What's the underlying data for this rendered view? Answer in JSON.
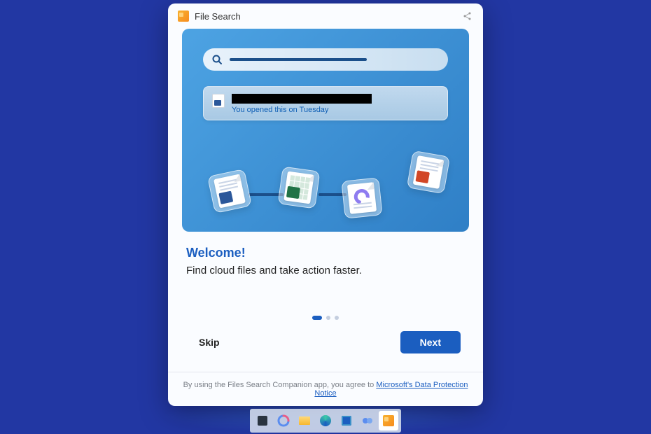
{
  "window": {
    "title": "File Search"
  },
  "hero": {
    "result_subtitle": "You opened this on Tuesday"
  },
  "content": {
    "heading": "Welcome!",
    "subtitle": "Find cloud files and take action faster."
  },
  "buttons": {
    "skip": "Skip",
    "next": "Next"
  },
  "footer": {
    "prefix": "By using the Files Search Companion app, you agree to ",
    "link_text": "Microsoft's Data Protection Notice"
  },
  "pagination": {
    "active_index": 0,
    "count": 3
  }
}
